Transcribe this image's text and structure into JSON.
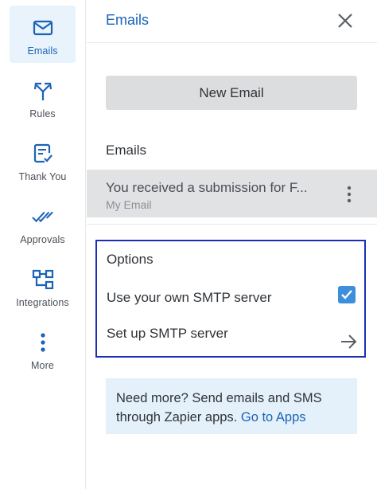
{
  "sidebar": {
    "items": [
      {
        "label": "Emails",
        "icon": "envelope-icon",
        "active": true
      },
      {
        "label": "Rules",
        "icon": "split-arrows-icon",
        "active": false
      },
      {
        "label": "Thank You",
        "icon": "form-check-icon",
        "active": false
      },
      {
        "label": "Approvals",
        "icon": "double-check-icon",
        "active": false
      },
      {
        "label": "Integrations",
        "icon": "integrations-icon",
        "active": false
      },
      {
        "label": "More",
        "icon": "vertical-dots-icon",
        "active": false
      }
    ]
  },
  "panel": {
    "title": "Emails",
    "new_email_label": "New Email",
    "emails_section_title": "Emails",
    "emails": [
      {
        "subject": "You received a submission for F...",
        "subtitle": "My Email"
      }
    ],
    "options": {
      "title": "Options",
      "smtp_own_label": "Use your own SMTP server",
      "smtp_own_checked": true,
      "smtp_setup_label": "Set up SMTP server"
    },
    "info": {
      "text": "Need more? Send emails and SMS through Zapier apps.",
      "link": "Go to Apps"
    }
  },
  "colors": {
    "accent": "#1c63b8",
    "highlight_border": "#1a2fb5",
    "checkbox": "#3d8fdc",
    "info_bg": "#e4f1fb"
  }
}
